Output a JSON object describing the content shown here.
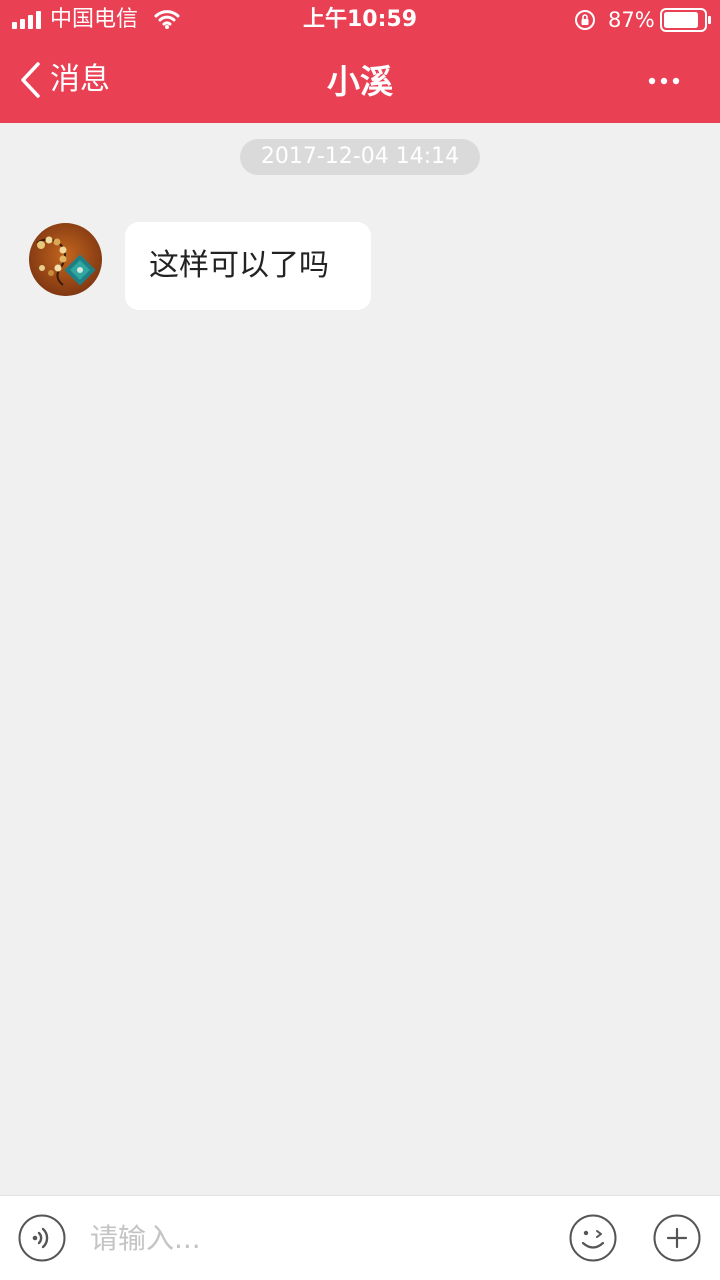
{
  "status_bar": {
    "carrier": "中国电信",
    "time": "上午10:59",
    "battery_percent": "87%",
    "battery_level": 0.87,
    "signal_icon": "signal-bars-icon",
    "wifi_icon": "wifi-icon",
    "rotation_lock_icon": "rotation-lock-icon"
  },
  "nav": {
    "back_label": "消息",
    "title": "小溪",
    "more_icon": "more-dots-icon",
    "background_color": "#e94054"
  },
  "chat": {
    "timestamp": "2017-12-04 14:14",
    "messages": [
      {
        "sender": "other",
        "text": "这样可以了吗"
      }
    ]
  },
  "input_bar": {
    "placeholder": "请输入...",
    "voice_icon": "voice-icon",
    "emoji_icon": "emoji-icon",
    "plus_icon": "plus-icon"
  }
}
